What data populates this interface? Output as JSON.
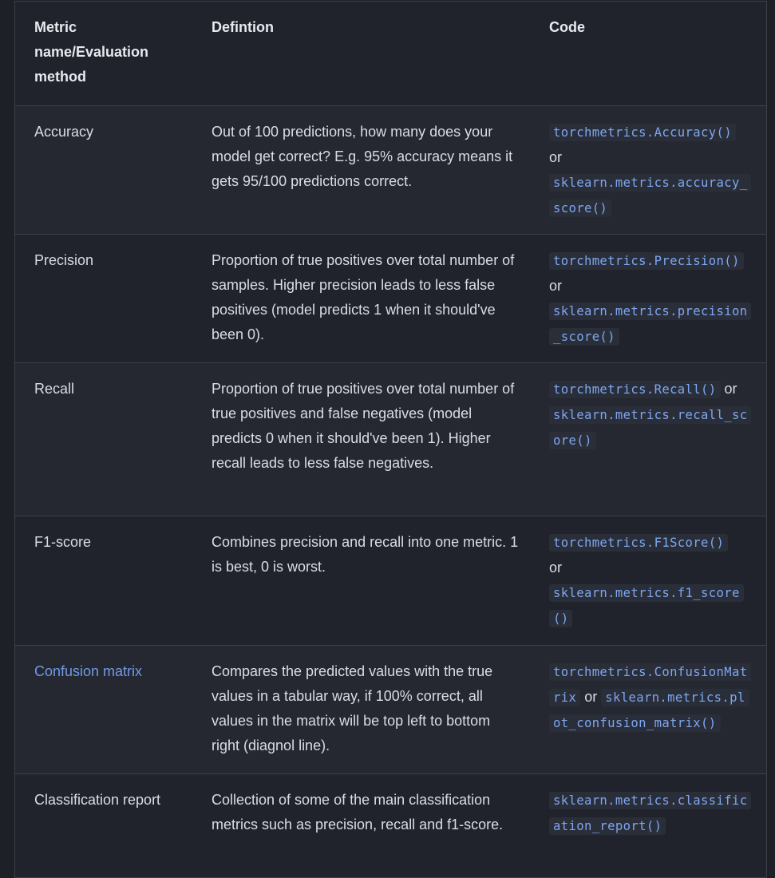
{
  "headers": {
    "metric": "Metric name/Evaluation method",
    "definition": "Defintion",
    "code": "Code"
  },
  "rows": [
    {
      "metric": "Accuracy",
      "definition": "Out of 100 predictions, how many does your model get correct? E.g. 95% accuracy means it gets 95/100 predictions correct.",
      "code1": "torchmetrics.Accuracy()",
      "joiner": "or",
      "code2": "sklearn.metrics.accuracy_score()"
    },
    {
      "metric": "Precision",
      "definition": "Proportion of true positives over total number of samples. Higher precision leads to less false positives (model predicts 1 when it should've been 0).",
      "code1": "torchmetrics.Precision()",
      "joiner": "or",
      "code2": "sklearn.metrics.precision_score()"
    },
    {
      "metric": "Recall",
      "definition": "Proportion of true positives over total number of true positives and false negatives (model predicts 0 when it should've been 1). Higher recall leads to less false negatives.",
      "code1": "torchmetrics.Recall()",
      "joiner": "or",
      "code2": "sklearn.metrics.recall_score()"
    },
    {
      "metric": "F1-score",
      "definition": "Combines precision and recall into one metric. 1 is best, 0 is worst.",
      "code1": "torchmetrics.F1Score()",
      "joiner": "or",
      "code2": "sklearn.metrics.f1_score()"
    },
    {
      "metric": "Confusion matrix",
      "definition": "Compares the predicted values with the true values in a tabular way, if 100% correct, all values in the matrix will be top left to bottom right (diagnol line).",
      "code1": "torchmetrics.ConfusionMatrix",
      "joiner": "or",
      "code2": "sklearn.metrics.plot_confusion_matrix()"
    },
    {
      "metric": "Classification report",
      "definition": "Collection of some of the main classification metrics such as precision, recall and f1-score.",
      "code1": "sklearn.metrics.classification_report()"
    }
  ],
  "colors": {
    "background": "#1e2028",
    "border": "#3c4049",
    "text": "#d9dde3",
    "link": "#6f9ae6",
    "code_text": "#7ea6f0",
    "code_bg": "#2a2e39"
  }
}
